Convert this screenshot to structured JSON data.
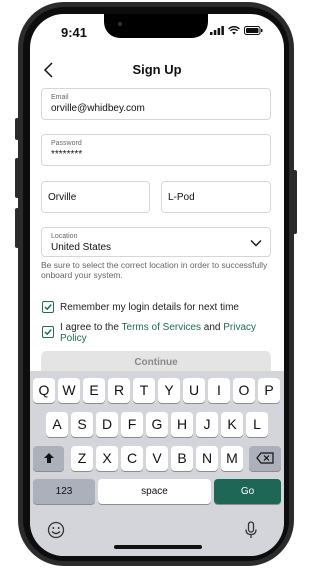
{
  "status": {
    "time": "9:41"
  },
  "nav": {
    "title": "Sign Up"
  },
  "form": {
    "email": {
      "label": "Email",
      "value": "orville@whidbey.com"
    },
    "password": {
      "label": "Password",
      "value": "********"
    },
    "first_name": {
      "value": "Orville"
    },
    "last_name": {
      "value": "L-Pod"
    },
    "location": {
      "label": "Location",
      "value": "United States"
    },
    "location_helper": "Be sure to select the correct location in order to successfully onboard your system.",
    "remember": {
      "label": "Remember my login details for next time",
      "checked": true
    },
    "agree": {
      "prefix": "I agree to the ",
      "terms": "Terms of Services",
      "middle": " and ",
      "privacy": "Privacy Policy",
      "checked": true
    },
    "continue_label": "Continue"
  },
  "keyboard": {
    "row1": [
      "Q",
      "W",
      "E",
      "R",
      "T",
      "Y",
      "U",
      "I",
      "O",
      "P"
    ],
    "row2": [
      "A",
      "S",
      "D",
      "F",
      "G",
      "H",
      "J",
      "K",
      "L"
    ],
    "row3": [
      "Z",
      "X",
      "C",
      "V",
      "B",
      "N",
      "M"
    ],
    "numbers_label": "123",
    "space_label": "space",
    "go_label": "Go"
  },
  "colors": {
    "accent": "#1e6757",
    "disabled": "#e4e4e4"
  }
}
